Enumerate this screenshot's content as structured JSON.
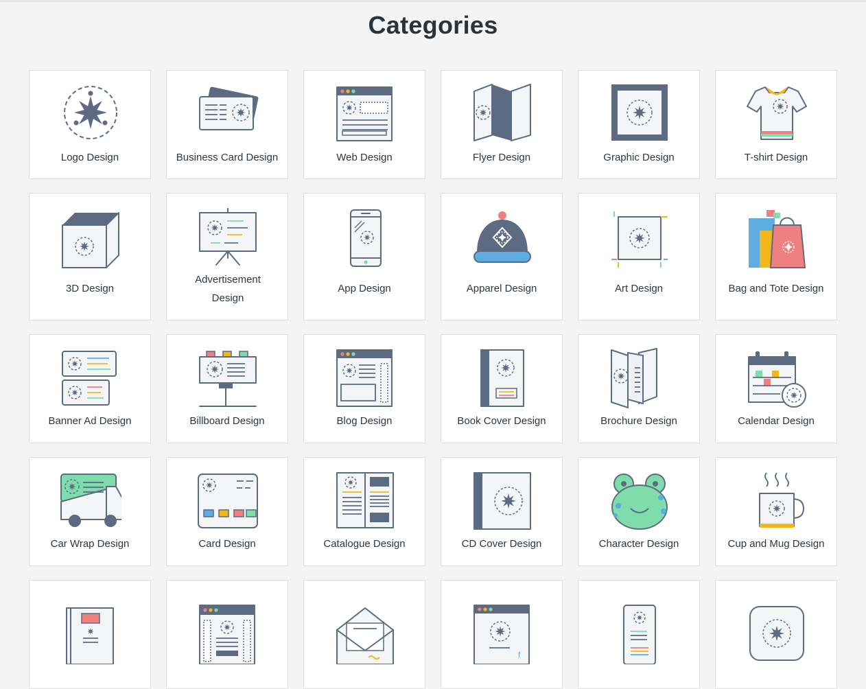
{
  "page": {
    "title": "Categories"
  },
  "colors": {
    "ink": "#5d6b82",
    "green": "#7fdcab",
    "yellow": "#f1b71c",
    "red": "#f07f7f",
    "blue": "#5dade2",
    "border": "#dcdfe2"
  },
  "categories": [
    {
      "label": "Logo Design",
      "icon": "logo-icon"
    },
    {
      "label": "Business Card Design",
      "icon": "business-card-icon"
    },
    {
      "label": "Web Design",
      "icon": "web-icon"
    },
    {
      "label": "Flyer Design",
      "icon": "flyer-icon"
    },
    {
      "label": "Graphic Design",
      "icon": "graphic-icon"
    },
    {
      "label": "T-shirt Design",
      "icon": "tshirt-icon"
    },
    {
      "label": "3D Design",
      "icon": "cube-icon"
    },
    {
      "label": "Advertisement Design",
      "icon": "easel-icon"
    },
    {
      "label": "App Design",
      "icon": "phone-icon"
    },
    {
      "label": "Apparel Design",
      "icon": "beanie-icon"
    },
    {
      "label": "Art Design",
      "icon": "art-frame-icon"
    },
    {
      "label": "Bag and Tote Design",
      "icon": "shopping-bags-icon"
    },
    {
      "label": "Banner Ad Design",
      "icon": "banner-icon"
    },
    {
      "label": "Billboard Design",
      "icon": "billboard-icon"
    },
    {
      "label": "Blog Design",
      "icon": "blog-icon"
    },
    {
      "label": "Book Cover Design",
      "icon": "book-icon"
    },
    {
      "label": "Brochure Design",
      "icon": "brochure-icon"
    },
    {
      "label": "Calendar Design",
      "icon": "calendar-icon"
    },
    {
      "label": "Car Wrap Design",
      "icon": "truck-icon"
    },
    {
      "label": "Card Design",
      "icon": "card-icon"
    },
    {
      "label": "Catalogue Design",
      "icon": "catalogue-icon"
    },
    {
      "label": "CD Cover Design",
      "icon": "cd-cover-icon"
    },
    {
      "label": "Character Design",
      "icon": "frog-character-icon"
    },
    {
      "label": "Cup and Mug Design",
      "icon": "mug-icon"
    },
    {
      "label": "",
      "icon": "book-cover-red-icon"
    },
    {
      "label": "",
      "icon": "browser-page-icon"
    },
    {
      "label": "",
      "icon": "envelope-icon"
    },
    {
      "label": "",
      "icon": "social-page-icon"
    },
    {
      "label": "",
      "icon": "tall-card-icon"
    },
    {
      "label": "",
      "icon": "app-icon"
    }
  ]
}
